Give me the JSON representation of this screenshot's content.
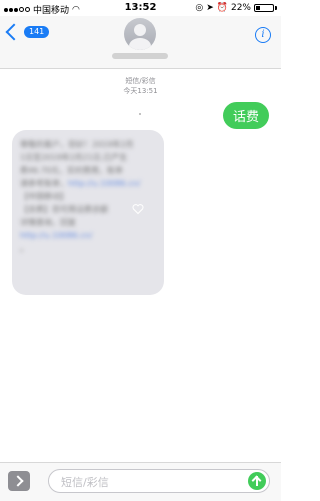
{
  "status_bar": {
    "carrier": "中国移动",
    "time": "13:52",
    "battery_percent": "22%",
    "battery_level": 0.22
  },
  "nav": {
    "back_count": "141"
  },
  "conversation": {
    "timestamp_type": "短信/彩信",
    "timestamp_time": "今天13:51",
    "outgoing_text": "话费",
    "incoming_text": [
      "尊敬的客户，您好！2019年2月",
      "1日至2019年2月21日,已产生",
      "费46.70元，实时费用，账单",
      "请参考账单，",
      "http://u.10086.cn/",
      "【中国移动】",
      "【余费】您可用话费余额",
      "详情查询，回复",
      "http://u.10086.cn/",
      "。"
    ]
  },
  "composer": {
    "placeholder": "短信/彩信"
  }
}
